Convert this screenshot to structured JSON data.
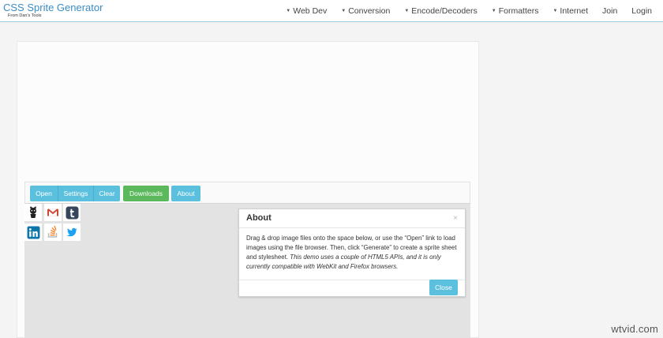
{
  "header": {
    "title": "CSS Sprite Generator",
    "subtitle": "From Dan's Tools",
    "nav": [
      {
        "label": "Web Dev",
        "dropdown": true
      },
      {
        "label": "Conversion",
        "dropdown": true
      },
      {
        "label": "Encode/Decoders",
        "dropdown": true
      },
      {
        "label": "Formatters",
        "dropdown": true
      },
      {
        "label": "Internet",
        "dropdown": true
      },
      {
        "label": "Join",
        "dropdown": false
      },
      {
        "label": "Login",
        "dropdown": false
      }
    ]
  },
  "toolbar": {
    "open_label": "Open",
    "settings_label": "Settings",
    "clear_label": "Clear",
    "downloads_label": "Downloads",
    "about_label": "About"
  },
  "sprites": [
    {
      "icon": "github-icon",
      "color": "#222222"
    },
    {
      "icon": "gmail-icon",
      "color": "#d14836"
    },
    {
      "icon": "tumblr-icon",
      "color": "#35465c"
    },
    {
      "icon": "linkedin-icon",
      "color": "#0e76a8"
    },
    {
      "icon": "stackoverflow-icon",
      "color": "#f48024"
    },
    {
      "icon": "twitter-icon",
      "color": "#1da1f2"
    }
  ],
  "dialog": {
    "title": "About",
    "close_x": "×",
    "body_text": "Drag & drop image files onto the space below, or use the “Open” link to load images using the file browser. Then, click “Generate” to create a sprite sheet and stylesheet.",
    "body_note": "This demo uses a couple of HTML5 APIs, and it is only currently compatible with WebKit and Firefox browsers.",
    "close_label": "Close"
  },
  "watermark": "wtvid.com",
  "colors": {
    "info": "#5bc0de",
    "success": "#5cb85c",
    "brand": "#3a8dc4"
  }
}
